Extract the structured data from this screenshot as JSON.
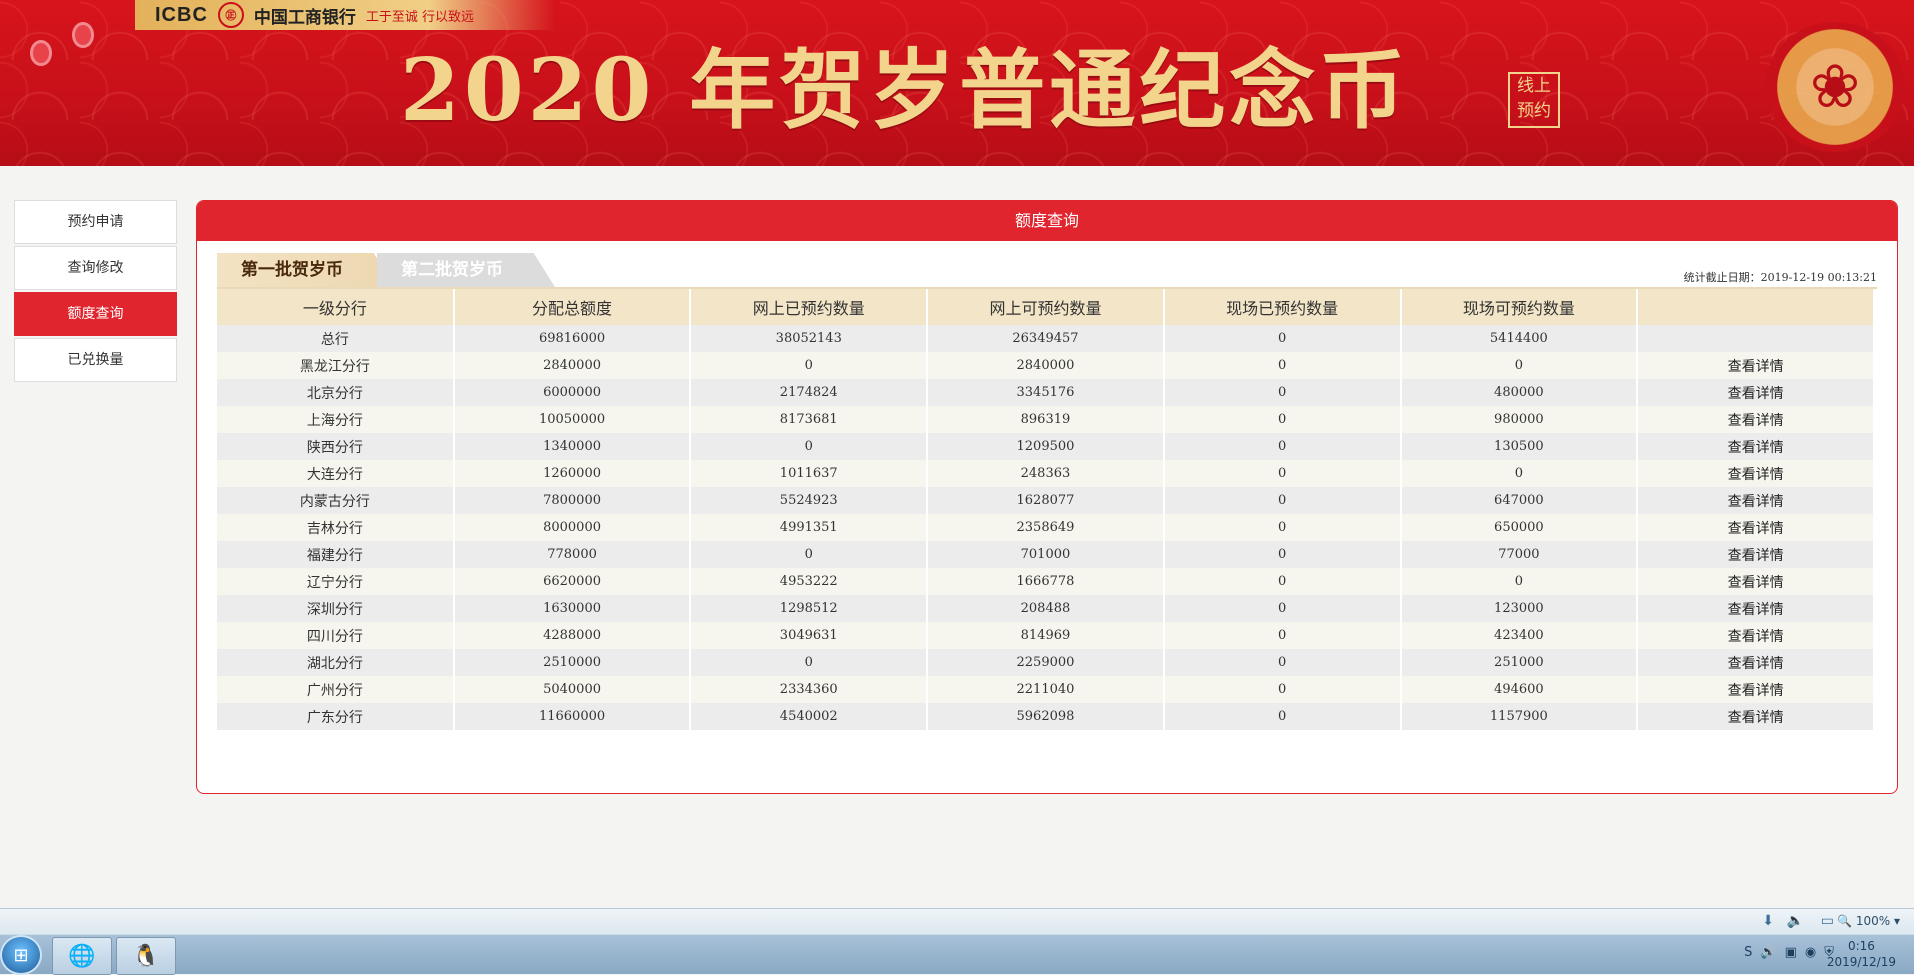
{
  "banner": {
    "logo_text": "ICBC",
    "logo_seal": "㊣",
    "bank_name": "中国工商银行",
    "slogan": "工于至诚 行以致远",
    "title": "2020 年贺岁普通纪念币",
    "online_line1": "线上",
    "online_line2": "预约"
  },
  "sidebar": {
    "items": [
      {
        "label": "预约申请"
      },
      {
        "label": "查询修改"
      },
      {
        "label": "额度查询"
      },
      {
        "label": "已兑换量"
      }
    ]
  },
  "panel": {
    "title": "额度查询",
    "tabs": [
      {
        "label": "第一批贺岁币"
      },
      {
        "label": "第二批贺岁币"
      }
    ],
    "stat_date": "统计截止日期：2019-12-19 00:13:21"
  },
  "table": {
    "headers": [
      "一级分行",
      "分配总额度",
      "网上已预约数量",
      "网上可预约数量",
      "现场已预约数量",
      "现场可预约数量",
      ""
    ],
    "rows": [
      {
        "name": "总行",
        "total": "69816000",
        "online_booked": "38052143",
        "online_available": "26349457",
        "site_booked": "0",
        "site_available": "5414400",
        "action": ""
      },
      {
        "name": "黑龙江分行",
        "total": "2840000",
        "online_booked": "0",
        "online_available": "2840000",
        "site_booked": "0",
        "site_available": "0",
        "action": "查看详情"
      },
      {
        "name": "北京分行",
        "total": "6000000",
        "online_booked": "2174824",
        "online_available": "3345176",
        "site_booked": "0",
        "site_available": "480000",
        "action": "查看详情"
      },
      {
        "name": "上海分行",
        "total": "10050000",
        "online_booked": "8173681",
        "online_available": "896319",
        "site_booked": "0",
        "site_available": "980000",
        "action": "查看详情"
      },
      {
        "name": "陕西分行",
        "total": "1340000",
        "online_booked": "0",
        "online_available": "1209500",
        "site_booked": "0",
        "site_available": "130500",
        "action": "查看详情"
      },
      {
        "name": "大连分行",
        "total": "1260000",
        "online_booked": "1011637",
        "online_available": "248363",
        "site_booked": "0",
        "site_available": "0",
        "action": "查看详情"
      },
      {
        "name": "内蒙古分行",
        "total": "7800000",
        "online_booked": "5524923",
        "online_available": "1628077",
        "site_booked": "0",
        "site_available": "647000",
        "action": "查看详情"
      },
      {
        "name": "吉林分行",
        "total": "8000000",
        "online_booked": "4991351",
        "online_available": "2358649",
        "site_booked": "0",
        "site_available": "650000",
        "action": "查看详情"
      },
      {
        "name": "福建分行",
        "total": "778000",
        "online_booked": "0",
        "online_available": "701000",
        "site_booked": "0",
        "site_available": "77000",
        "action": "查看详情"
      },
      {
        "name": "辽宁分行",
        "total": "6620000",
        "online_booked": "4953222",
        "online_available": "1666778",
        "site_booked": "0",
        "site_available": "0",
        "action": "查看详情"
      },
      {
        "name": "深圳分行",
        "total": "1630000",
        "online_booked": "1298512",
        "online_available": "208488",
        "site_booked": "0",
        "site_available": "123000",
        "action": "查看详情"
      },
      {
        "name": "四川分行",
        "total": "4288000",
        "online_booked": "3049631",
        "online_available": "814969",
        "site_booked": "0",
        "site_available": "423400",
        "action": "查看详情"
      },
      {
        "name": "湖北分行",
        "total": "2510000",
        "online_booked": "0",
        "online_available": "2259000",
        "site_booked": "0",
        "site_available": "251000",
        "action": "查看详情"
      },
      {
        "name": "广州分行",
        "total": "5040000",
        "online_booked": "2334360",
        "online_available": "2211040",
        "site_booked": "0",
        "site_available": "494600",
        "action": "查看详情"
      },
      {
        "name": "广东分行",
        "total": "11660000",
        "online_booked": "4540002",
        "online_available": "5962098",
        "site_booked": "0",
        "site_available": "1157900",
        "action": "查看详情"
      }
    ]
  },
  "browser": {
    "zoom": "100%",
    "icons": [
      "download-icon",
      "speaker-icon",
      "compat-icon",
      "zoom-icon"
    ]
  },
  "taskbar": {
    "time": "0:16",
    "date": "2019/12/19",
    "tray_icons": [
      "sogou-icon",
      "volume-icon",
      "network-icon",
      "qq-icon",
      "shield-icon"
    ]
  }
}
